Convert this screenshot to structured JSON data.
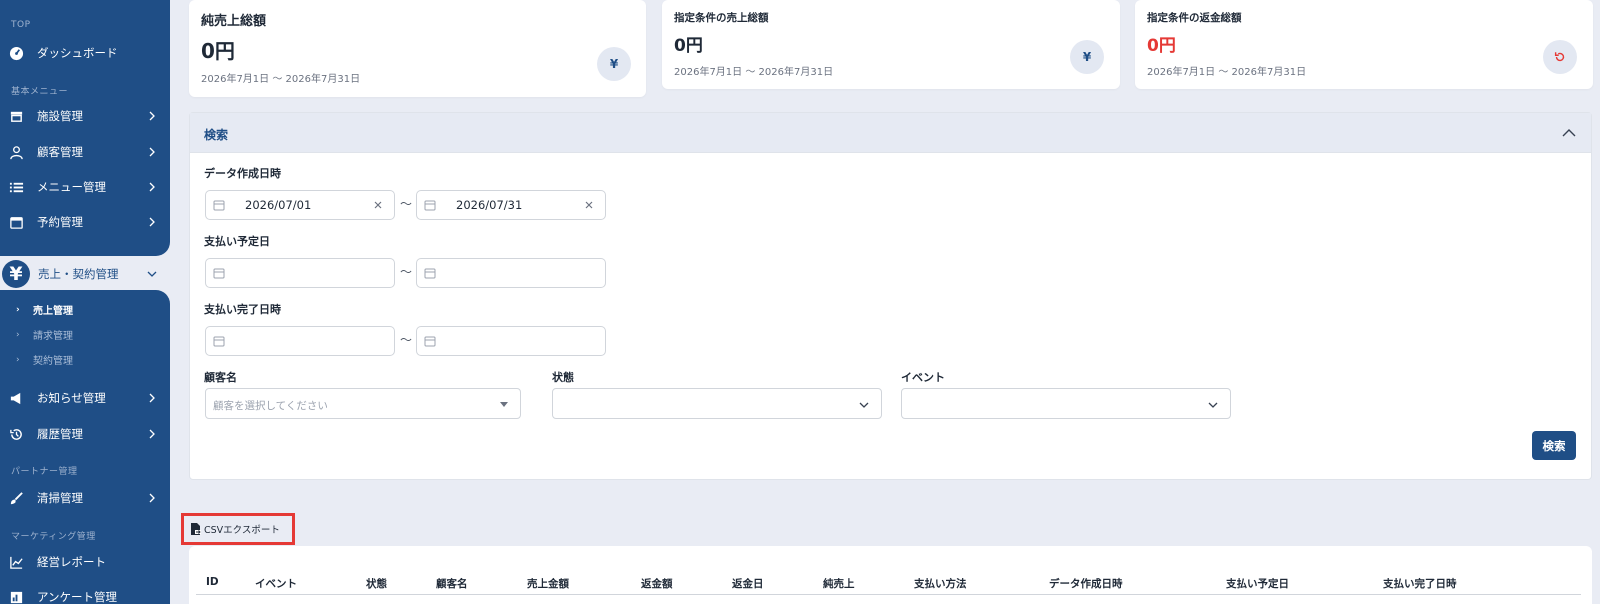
{
  "sidebar": {
    "sections": {
      "top": "TOP",
      "basic": "基本メニュー",
      "partner": "パートナー管理",
      "marketing": "マーケティング管理"
    },
    "items": {
      "dashboard": "ダッシュボード",
      "facility": "施設管理",
      "customer": "顧客管理",
      "menu": "メニュー管理",
      "reservation": "予約管理",
      "sales_contract": "売上・契約管理",
      "notice": "お知らせ管理",
      "history": "履歴管理",
      "cleaning": "清掃管理",
      "report": "経営レポート",
      "survey": "アンケート管理"
    },
    "sub_items": {
      "sales": "売上管理",
      "billing": "請求管理",
      "contract": "契約管理"
    }
  },
  "cards": [
    {
      "label": "純売上総額",
      "value": "0円",
      "range": "2026年7月1日 〜 2026年7月31日",
      "icon": "¥"
    },
    {
      "label": "指定条件の売上総額",
      "value": "0円",
      "range": "2026年7月1日 〜 2026年7月31日",
      "icon": "¥"
    },
    {
      "label": "指定条件の返金総額",
      "value": "0円",
      "range": "2026年7月1日 〜 2026年7月31日",
      "icon": "refund-icon"
    }
  ],
  "colors": {
    "accent": "#1f4e86",
    "danger": "#e53935"
  },
  "search": {
    "title": "検索",
    "created_label": "データ作成日時",
    "created_from": "2026/07/01",
    "created_to": "2026/07/31",
    "tilde": "〜",
    "due_label": "支払い予定日",
    "completed_label": "支払い完了日時",
    "customer_label": "顧客名",
    "customer_placeholder": "顧客を選択してください",
    "status_label": "状態",
    "event_label": "イベント",
    "submit": "検索"
  },
  "export": {
    "label": "CSVエクスポート"
  },
  "table": {
    "headers": [
      "ID",
      "イベント",
      "状態",
      "顧客名",
      "売上金額",
      "返金額",
      "返金日",
      "純売上",
      "支払い方法",
      "データ作成日時",
      "支払い予定日",
      "支払い完了日時"
    ]
  }
}
